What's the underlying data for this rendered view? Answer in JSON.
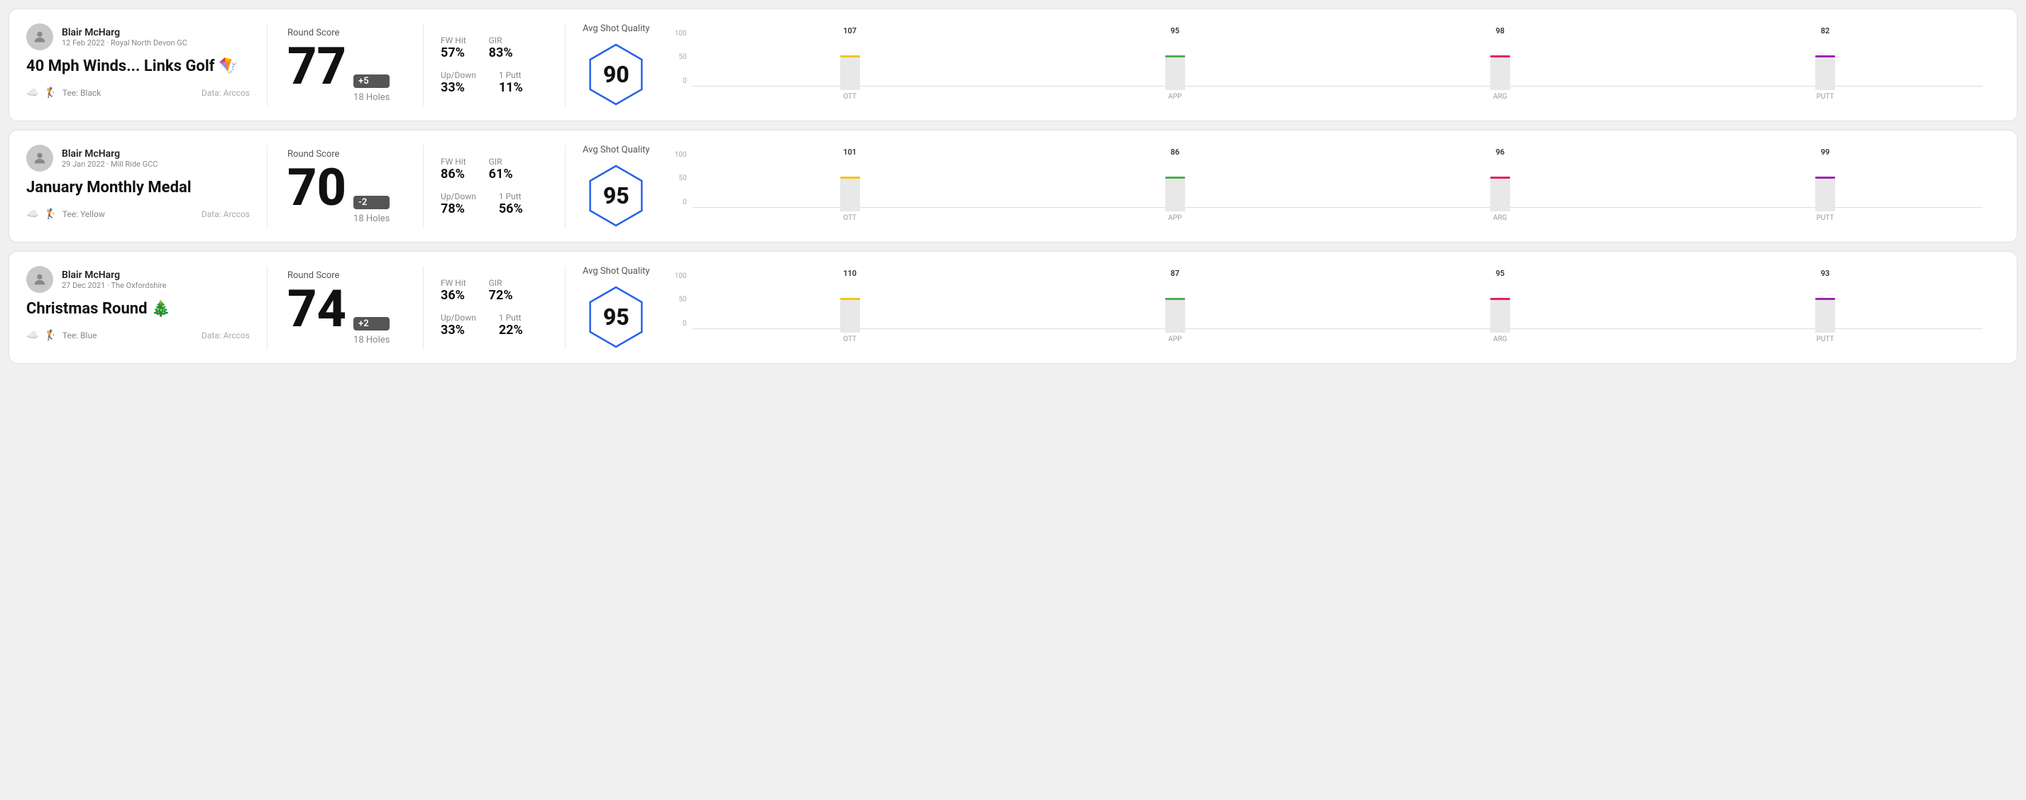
{
  "rounds": [
    {
      "id": "round1",
      "user": {
        "name": "Blair McHarg",
        "meta": "12 Feb 2022 · Royal North Devon GC"
      },
      "title": "40 Mph Winds... Links Golf 🪁",
      "tee": "Black",
      "data_source": "Data: Arccos",
      "score": {
        "label": "Round Score",
        "value": "77",
        "badge": "+5",
        "badge_type": "positive",
        "holes": "18 Holes"
      },
      "stats": {
        "fw_hit_label": "FW Hit",
        "fw_hit_value": "57%",
        "gir_label": "GIR",
        "gir_value": "83%",
        "updown_label": "Up/Down",
        "updown_value": "33%",
        "oneputt_label": "1 Putt",
        "oneputt_value": "11%"
      },
      "quality": {
        "label": "Avg Shot Quality",
        "score": "90",
        "chart": {
          "bars": [
            {
              "label": "OTT",
              "value": 107,
              "color": "#f5c518"
            },
            {
              "label": "APP",
              "value": 95,
              "color": "#4caf50"
            },
            {
              "label": "ARG",
              "value": 98,
              "color": "#e91e63"
            },
            {
              "label": "PUTT",
              "value": 82,
              "color": "#9c27b0"
            }
          ],
          "max": 130
        }
      }
    },
    {
      "id": "round2",
      "user": {
        "name": "Blair McHarg",
        "meta": "29 Jan 2022 · Mill Ride GCC"
      },
      "title": "January Monthly Medal",
      "tee": "Yellow",
      "data_source": "Data: Arccos",
      "score": {
        "label": "Round Score",
        "value": "70",
        "badge": "-2",
        "badge_type": "negative",
        "holes": "18 Holes"
      },
      "stats": {
        "fw_hit_label": "FW Hit",
        "fw_hit_value": "86%",
        "gir_label": "GIR",
        "gir_value": "61%",
        "updown_label": "Up/Down",
        "updown_value": "78%",
        "oneputt_label": "1 Putt",
        "oneputt_value": "56%"
      },
      "quality": {
        "label": "Avg Shot Quality",
        "score": "95",
        "chart": {
          "bars": [
            {
              "label": "OTT",
              "value": 101,
              "color": "#f5c518"
            },
            {
              "label": "APP",
              "value": 86,
              "color": "#4caf50"
            },
            {
              "label": "ARG",
              "value": 96,
              "color": "#e91e63"
            },
            {
              "label": "PUTT",
              "value": 99,
              "color": "#9c27b0"
            }
          ],
          "max": 130
        }
      }
    },
    {
      "id": "round3",
      "user": {
        "name": "Blair McHarg",
        "meta": "27 Dec 2021 · The Oxfordshire"
      },
      "title": "Christmas Round 🎄",
      "tee": "Blue",
      "data_source": "Data: Arccos",
      "score": {
        "label": "Round Score",
        "value": "74",
        "badge": "+2",
        "badge_type": "positive",
        "holes": "18 Holes"
      },
      "stats": {
        "fw_hit_label": "FW Hit",
        "fw_hit_value": "36%",
        "gir_label": "GIR",
        "gir_value": "72%",
        "updown_label": "Up/Down",
        "updown_value": "33%",
        "oneputt_label": "1 Putt",
        "oneputt_value": "22%"
      },
      "quality": {
        "label": "Avg Shot Quality",
        "score": "95",
        "chart": {
          "bars": [
            {
              "label": "OTT",
              "value": 110,
              "color": "#f5c518"
            },
            {
              "label": "APP",
              "value": 87,
              "color": "#4caf50"
            },
            {
              "label": "ARG",
              "value": 95,
              "color": "#e91e63"
            },
            {
              "label": "PUTT",
              "value": 93,
              "color": "#9c27b0"
            }
          ],
          "max": 130
        }
      }
    }
  ],
  "axis_labels": {
    "top": "100",
    "mid": "50",
    "bot": "0"
  }
}
